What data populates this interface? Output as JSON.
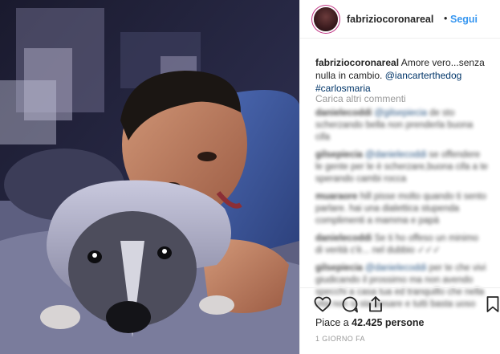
{
  "post": {
    "photo_alt": "",
    "header": {
      "username": "fabriziocoronareal",
      "separator": "•",
      "follow_label": "Segui"
    },
    "caption": {
      "username": "fabriziocoronareal",
      "text": " Amore vero...senza nulla in cambio. ",
      "mention": "@iancarterthedog",
      "hashtag": "#carlosmaria"
    },
    "load_more_label": "Carica altri commenti",
    "comments": [
      {
        "user": "danielecoddi",
        "mention": "@gilsepiecia",
        "text": " de sto scherzando bella non prenderla buona cifa"
      },
      {
        "user": "gilsepiecia",
        "mention": "@danielecoddi",
        "text": " se offendere le gente per le è scherzare,buona cifa a te sperando cambi rocca"
      },
      {
        "user": "muaraore",
        "mention": "",
        "text": " hill pisse molto quando ti sento parlare. hai una dialettica stupenda complimenti a mamma e papà"
      },
      {
        "user": "danielecoddi",
        "mention": "",
        "text": " Se ti ho offeso un minimo di verità c'è... nel dubbio ✓✓✓"
      },
      {
        "user": "gilsepiecia",
        "mention": "@danielecoddi",
        "text": " per te che vivi giudicando il prossimo ma non avendo specchi a casa tua ed tranquillo che nella vita non si sta pesare e tutti basta uoso"
      }
    ],
    "actions": {
      "like_icon": "heart-icon",
      "comment_icon": "comment-icon",
      "share_icon": "share-icon",
      "save_icon": "bookmark-icon"
    },
    "likes": {
      "prefix": "Piace a ",
      "count": "42.425",
      "suffix": " persone"
    },
    "timestamp": "1 giorno fa"
  }
}
